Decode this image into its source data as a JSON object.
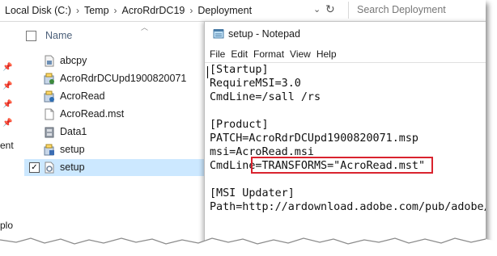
{
  "explorer": {
    "breadcrumbs": [
      "Local Disk (C:)",
      "Temp",
      "AcroRdrDC19",
      "Deployment"
    ],
    "search_placeholder": "Search Deployment",
    "column_name": "Name",
    "nav_partial_text": [
      "ent",
      "plo"
    ],
    "files": [
      {
        "name": "abcpy",
        "icon": "script-file-icon",
        "selected": false,
        "checked": false
      },
      {
        "name": "AcroRdrDCUpd1900820071",
        "icon": "installer-patch-icon",
        "selected": false,
        "checked": false
      },
      {
        "name": "AcroRead",
        "icon": "installer-package-icon",
        "selected": false,
        "checked": false
      },
      {
        "name": "AcroRead.mst",
        "icon": "blank-file-icon",
        "selected": false,
        "checked": false
      },
      {
        "name": "Data1",
        "icon": "cabinet-file-icon",
        "selected": false,
        "checked": false
      },
      {
        "name": "setup",
        "icon": "setup-exe-icon",
        "selected": false,
        "checked": false
      },
      {
        "name": "setup",
        "icon": "settings-file-icon",
        "selected": true,
        "checked": true
      }
    ]
  },
  "notepad": {
    "title": "setup - Notepad",
    "menu": [
      "File",
      "Edit",
      "Format",
      "View",
      "Help"
    ],
    "lines": [
      "[Startup]",
      "RequireMSI=3.0",
      "CmdLine=/sall /rs",
      "",
      "[Product]",
      "PATCH=AcroRdrDCUpd1900820071.msp",
      "msi=AcroRead.msi",
      "CmdLine=TRANSFORMS=\"AcroRead.mst\"",
      "",
      "[MSI Updater]",
      "Path=http://ardownload.adobe.com/pub/adobe/"
    ],
    "highlight_color": "#d9232e"
  }
}
